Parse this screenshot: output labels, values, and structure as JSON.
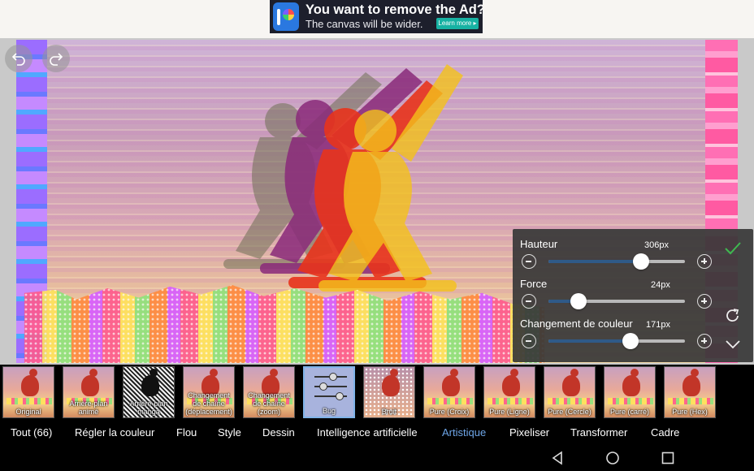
{
  "ad": {
    "title": "You want to remove the Ad?",
    "subtitle": "The canvas will be wider.",
    "cta": "Learn more"
  },
  "toolbar": {
    "undo_icon": "undo-icon",
    "redo_icon": "redo-icon"
  },
  "panel": {
    "sliders": [
      {
        "label": "Hauteur",
        "value": "306px",
        "fraction": 0.68
      },
      {
        "label": "Force",
        "value": "24px",
        "fraction": 0.22
      },
      {
        "label": "Changement de couleur",
        "value": "171px",
        "fraction": 0.6
      }
    ],
    "apply_icon": "check-icon",
    "reset_icon": "reset-icon",
    "collapse_icon": "chevron-down-icon"
  },
  "effects": [
    {
      "label": "Original",
      "style": "photo"
    },
    {
      "label": "Arrière-plan animé",
      "style": "photo"
    },
    {
      "label": "Arrière-plan manga",
      "style": "manga"
    },
    {
      "label": "Changement de chaîne (déplacement)",
      "style": "photo"
    },
    {
      "label": "Changement de chaîne (zoom)",
      "style": "photo"
    },
    {
      "label": "Bug",
      "style": "bug",
      "selected": true
    },
    {
      "label": "Bruit",
      "style": "noise"
    },
    {
      "label": "Pure (Croix)",
      "style": "photo"
    },
    {
      "label": "Pure (Ligne)",
      "style": "photo"
    },
    {
      "label": "Pure (Cercle)",
      "style": "photo"
    },
    {
      "label": "Pure (carré)",
      "style": "photo"
    },
    {
      "label": "Pure (Hex)",
      "style": "photo"
    }
  ],
  "categories": [
    {
      "label": "Tout (66)"
    },
    {
      "label": "Régler la couleur"
    },
    {
      "label": "Flou"
    },
    {
      "label": "Style"
    },
    {
      "label": "Dessin"
    },
    {
      "label": "Intelligence artificielle"
    },
    {
      "label": "Artistique",
      "active": true
    },
    {
      "label": "Pixeliser"
    },
    {
      "label": "Transformer"
    },
    {
      "label": "Cadre"
    }
  ],
  "colors": {
    "accent": "#6ea6e8",
    "slider_fill": "#2f5a88",
    "check": "#3fb950"
  }
}
